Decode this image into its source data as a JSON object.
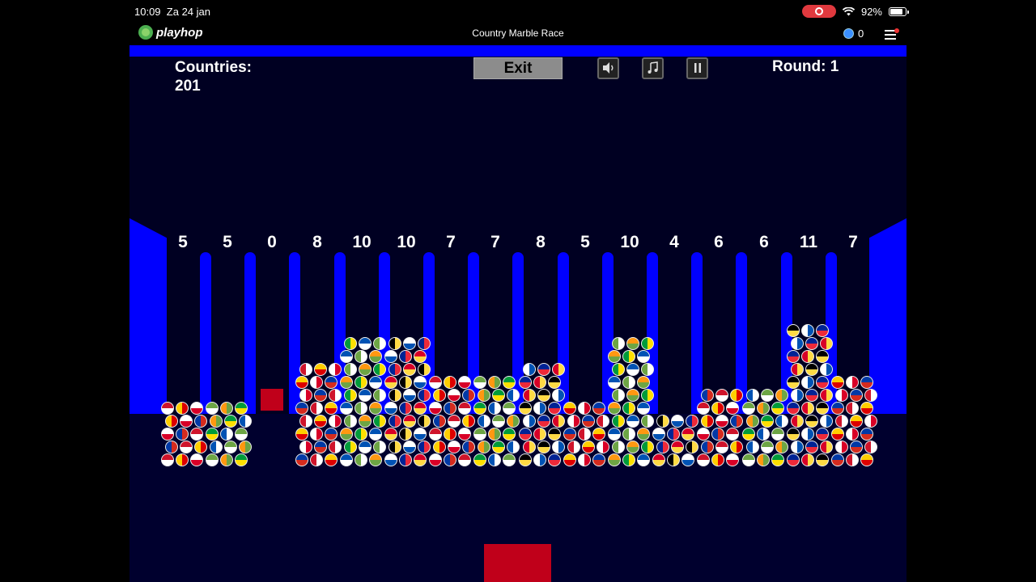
{
  "status_bar": {
    "time": "10:09",
    "date": "Za 24 jan",
    "battery": "92%",
    "battery_level": 0.92
  },
  "site": {
    "logo": "playhop",
    "title": "Country Marble Race",
    "coins": "0"
  },
  "hud": {
    "countries_label": "Countries:",
    "countries_value": "201",
    "exit_label": "Exit",
    "round_label": "Round: 1",
    "sound_icon": "speaker-icon",
    "music_icon": "music-note-icon",
    "pause_icon": "pause-icon"
  },
  "bins": [
    {
      "count": "5"
    },
    {
      "count": "5"
    },
    {
      "count": "0"
    },
    {
      "count": "8"
    },
    {
      "count": "10"
    },
    {
      "count": "10"
    },
    {
      "count": "7"
    },
    {
      "count": "7"
    },
    {
      "count": "8"
    },
    {
      "count": "5"
    },
    {
      "count": "10"
    },
    {
      "count": "4"
    },
    {
      "count": "6"
    },
    {
      "count": "6"
    },
    {
      "count": "11"
    },
    {
      "count": "7"
    }
  ],
  "colors": {
    "wall": "#0000ff",
    "background": "#000022",
    "floor": "#00002e",
    "block": "#c0001a",
    "exit_button": "#8c8c8c"
  }
}
